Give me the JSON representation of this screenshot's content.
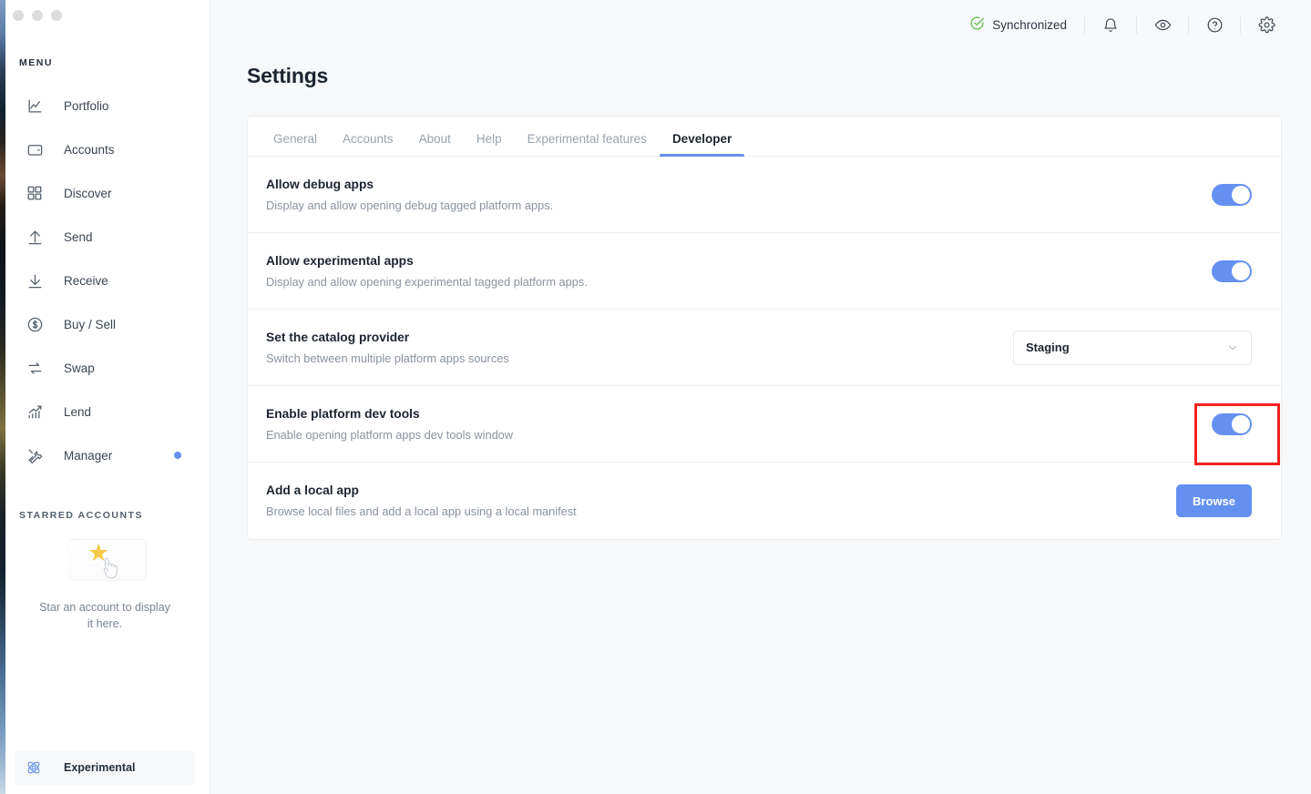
{
  "window": {
    "traffic_lights": [
      "close",
      "minimize",
      "maximize"
    ]
  },
  "sidebar": {
    "menu_heading": "MENU",
    "items": [
      {
        "label": "Portfolio",
        "icon": "line-chart-icon",
        "badge": false
      },
      {
        "label": "Accounts",
        "icon": "wallet-icon",
        "badge": false
      },
      {
        "label": "Discover",
        "icon": "grid-icon",
        "badge": false
      },
      {
        "label": "Send",
        "icon": "arrow-up-icon",
        "badge": false
      },
      {
        "label": "Receive",
        "icon": "arrow-down-icon",
        "badge": false
      },
      {
        "label": "Buy / Sell",
        "icon": "dollar-circle-icon",
        "badge": false
      },
      {
        "label": "Swap",
        "icon": "swap-arrows-icon",
        "badge": false
      },
      {
        "label": "Lend",
        "icon": "growth-chart-icon",
        "badge": false
      },
      {
        "label": "Manager",
        "icon": "tools-icon",
        "badge": true
      }
    ],
    "starred_heading": "STARRED ACCOUNTS",
    "starred_empty_text": "Star an account to display it here.",
    "bottom_item": {
      "label": "Experimental",
      "icon": "atom-icon"
    }
  },
  "topbar": {
    "sync_status": "Synchronized",
    "sync_icon": "check-circle-icon",
    "icons": [
      {
        "name": "bell-icon"
      },
      {
        "name": "eye-icon"
      },
      {
        "name": "help-circle-icon"
      },
      {
        "name": "gear-icon"
      }
    ]
  },
  "page": {
    "title": "Settings"
  },
  "tabs": [
    {
      "label": "General",
      "active": false
    },
    {
      "label": "Accounts",
      "active": false
    },
    {
      "label": "About",
      "active": false
    },
    {
      "label": "Help",
      "active": false
    },
    {
      "label": "Experimental features",
      "active": false
    },
    {
      "label": "Developer",
      "active": true
    }
  ],
  "rows": [
    {
      "title": "Allow debug apps",
      "desc": "Display and allow opening debug tagged platform apps.",
      "control": "toggle",
      "toggle_on": true
    },
    {
      "title": "Allow experimental apps",
      "desc": "Display and allow opening experimental tagged platform apps.",
      "control": "toggle",
      "toggle_on": true
    },
    {
      "title": "Set the catalog provider",
      "desc": "Switch between multiple platform apps sources",
      "control": "select",
      "select_value": "Staging"
    },
    {
      "title": "Enable platform dev tools",
      "desc": "Enable opening platform apps dev tools window",
      "control": "toggle",
      "toggle_on": true
    },
    {
      "title": "Add a local app",
      "desc": "Browse local files and add a local app using a local manifest",
      "control": "button",
      "button_label": "Browse"
    }
  ],
  "annotation": {
    "type": "highlight-rectangle",
    "color": "#f42121",
    "target": "enable-platform-dev-tools-toggle"
  },
  "colors": {
    "accent": "#6490f1",
    "success": "#66be54",
    "star": "#f7c948",
    "text_primary": "#1c2430",
    "text_muted": "#8a939e"
  }
}
